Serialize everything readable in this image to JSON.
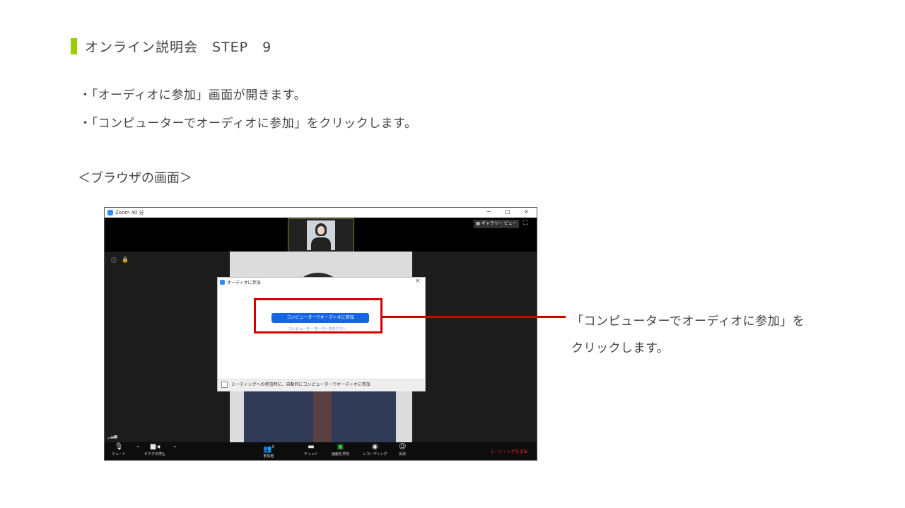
{
  "header": {
    "title": "オンライン説明会　STEP　9"
  },
  "bullets": [
    "・「オーディオに参加」画面が開きます。",
    "・「コンピューターでオーディオに参加」をクリックします。"
  ],
  "caption": "＜ブラウザの画面＞",
  "zoom": {
    "window_title": "Zoom 40 分",
    "win_min": "−",
    "win_max": "□",
    "win_close": "×",
    "gallery_view": "ギャラリー ビュー",
    "toolbar": {
      "mute": "ミュート",
      "stop_video": "ビデオの停止",
      "participants": "参加者",
      "participants_count": "3",
      "chat": "チャット",
      "share": "画面を共有",
      "record": "レコーディング",
      "reactions": "反応",
      "leave": "ミーティングを退出"
    },
    "dialog": {
      "title": "オーディオに参加",
      "close": "×",
      "join_button": "コンピューターでオーディオに参加",
      "test_link": "コンピューター オーディオのテスト",
      "auto_join_label": "ミーティングへの参加時に、自動的にコンピューターでオーディオに参加"
    }
  },
  "callout": {
    "line1": "「コンピューターでオーディオに参加」を",
    "line2": "クリックします。"
  },
  "colors": {
    "accent_green": "#9acd00",
    "annotation_red": "#d40000",
    "zoom_blue": "#1565e6"
  }
}
